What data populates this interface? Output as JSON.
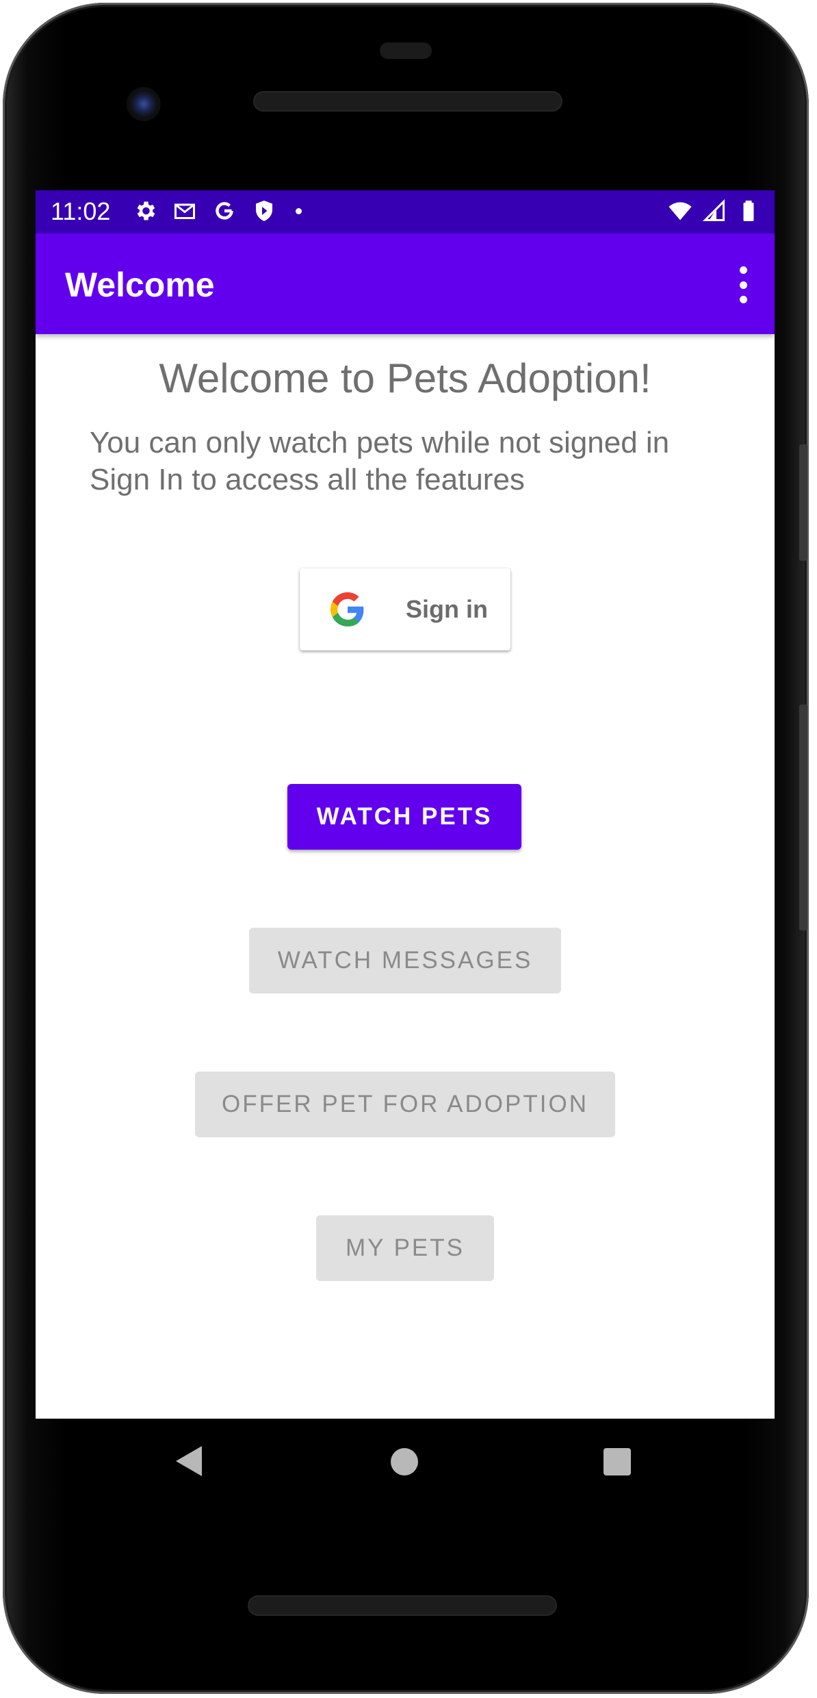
{
  "status_bar": {
    "time": "11:02",
    "icons_left": [
      "gear-icon",
      "gmail-icon",
      "google-icon",
      "shield-icon",
      "dot-icon"
    ],
    "icons_right": [
      "wifi-icon",
      "signal-icon",
      "battery-icon"
    ]
  },
  "app_bar": {
    "title": "Welcome",
    "overflow_icon": "more-vert-icon"
  },
  "content": {
    "heading": "Welcome to Pets Adoption!",
    "subtext_line1": "You can only watch pets while not signed in",
    "subtext_line2": "Sign In to access all the features"
  },
  "google_signin": {
    "label": "Sign in"
  },
  "buttons": {
    "watch_pets": "WATCH PETS",
    "watch_messages": "WATCH MESSAGES",
    "offer_pet": "OFFER PET FOR ADOPTION",
    "my_pets": "MY PETS"
  },
  "colors": {
    "status_bar": "#3700b3",
    "app_bar": "#6200ee",
    "primary_button": "#6200ee",
    "disabled_button": "#e0e0e0"
  }
}
